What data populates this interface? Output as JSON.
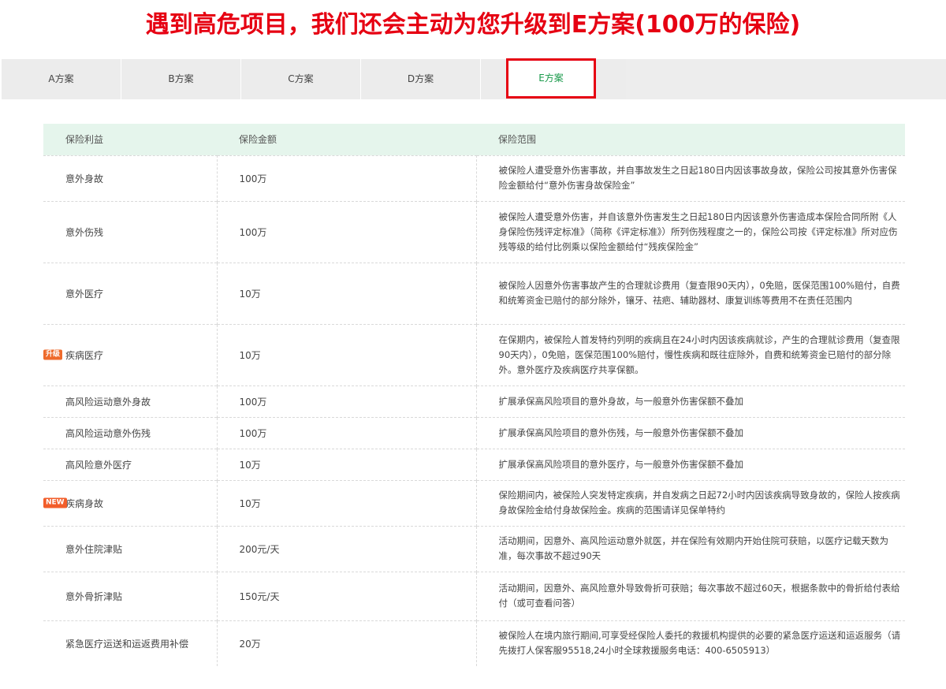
{
  "headline": "遇到高危项目，我们还会主动为您升级到E方案(100万的保险)",
  "tabs": [
    "A方案",
    "B方案",
    "C方案",
    "D方案",
    "E方案"
  ],
  "active_tab": "E方案",
  "table": {
    "headers": [
      "保险利益",
      "保险金额",
      "保险范围"
    ],
    "rows": [
      {
        "benefit": "意外身故",
        "amount": "100万",
        "scope": "被保险人遭受意外伤害事故，并自事故发生之日起180日内因该事故身故，保险公司按其意外伤害保险金额给付“意外伤害身故保险金”"
      },
      {
        "benefit": "意外伤残",
        "amount": "100万",
        "scope": "被保险人遭受意外伤害，并自该意外伤害发生之日起180日内因该意外伤害造成本保险合同所附《人身保险伤残评定标准》（简称《评定标准》）所列伤残程度之一的，保险公司按《评定标准》所对应伤残等级的给付比例乘以保险金额给付“残疾保险金”"
      },
      {
        "benefit": "意外医疗",
        "amount": "10万",
        "scope": "被保险人因意外伤害事故产生的合理就诊费用（复查限90天内），0免赔，医保范围100%赔付，自费和统筹资金已赔付的部分除外，镶牙、祛疤、辅助器材、康复训练等费用不在责任范围内"
      },
      {
        "benefit": "疾病医疗",
        "amount": "10万",
        "badge": "升级",
        "badge_type": "up",
        "scope": "在保期内，被保险人首发特约列明的疾病且在24小时内因该疾病就诊，产生的合理就诊费用（复查限90天内），0免赔，医保范围100%赔付，慢性疾病和既往症除外，自费和统筹资金已赔付的部分除外。意外医疗及疾病医疗共享保额。"
      },
      {
        "benefit": "高风险运动意外身故",
        "amount": "100万",
        "scope": "扩展承保高风险项目的意外身故，与一般意外伤害保额不叠加"
      },
      {
        "benefit": "高风险运动意外伤残",
        "amount": "100万",
        "scope": "扩展承保高风险项目的意外伤残，与一般意外伤害保额不叠加"
      },
      {
        "benefit": "高风险意外医疗",
        "amount": "10万",
        "scope": "扩展承保高风险项目的意外医疗，与一般意外伤害保额不叠加"
      },
      {
        "benefit": "疾病身故",
        "amount": "10万",
        "badge": "NEW",
        "badge_type": "new",
        "scope": "保险期间内，被保险人突发特定疾病，并自发病之日起72小时内因该疾病导致身故的，保险人按疾病身故保险金给付身故保险金。疾病的范围请详见保单特约"
      },
      {
        "benefit": "意外住院津贴",
        "amount": "200元/天",
        "scope": "活动期间，因意外、高风险运动意外就医，并在保险有效期内开始住院可获赔，以医疗记载天数为准，每次事故不超过90天"
      },
      {
        "benefit": "意外骨折津贴",
        "amount": "150元/天",
        "scope": "活动期间，因意外、高风险意外导致骨折可获赔；每次事故不超过60天，根据条款中的骨折给付表给付（或可查看问答）"
      },
      {
        "benefit": "紧急医疗运送和运返费用补偿",
        "amount": "20万",
        "scope": "被保险人在境内旅行期间,可享受经保险人委托的救援机构提供的必要的紧急医疗运送和运返服务（请先拨打人保客服95518,24小时全球救援服务电话：400-6505913）"
      }
    ]
  }
}
